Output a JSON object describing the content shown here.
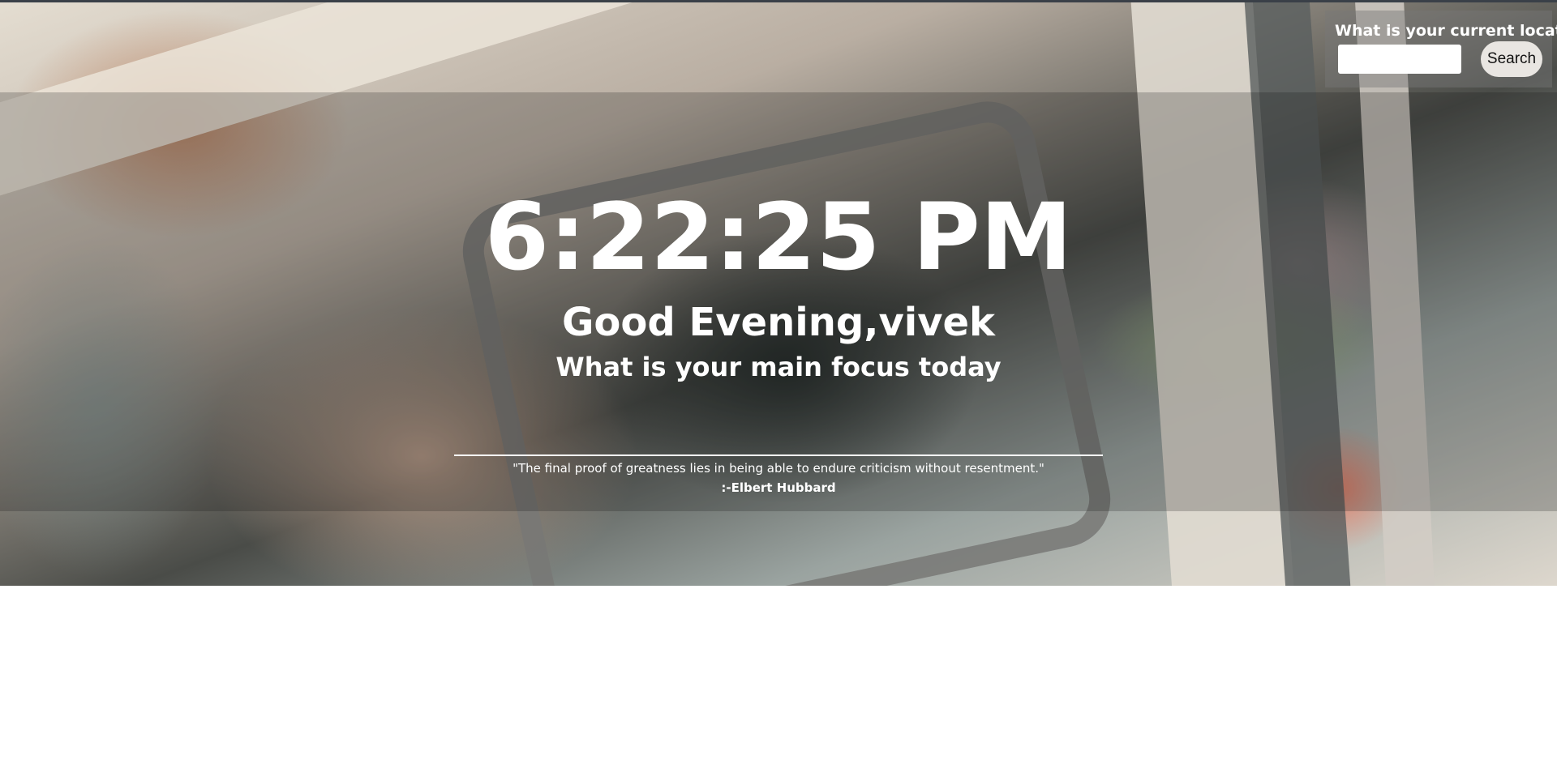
{
  "location": {
    "label": "What is your current location",
    "input_value": "",
    "search_label": "Search"
  },
  "clock": {
    "time": "6:22:25 PM"
  },
  "greeting": {
    "text": "Good Evening,vivek"
  },
  "focus": {
    "prompt": "What is your main focus today"
  },
  "quote": {
    "text": "\"The final proof of greatness lies in being able to endure criticism without resentment.\"",
    "author": ":-Elbert Hubbard"
  },
  "colors": {
    "text": "#ffffff",
    "button_bg": "#e9e6e2",
    "top_line": "#3a4048"
  }
}
